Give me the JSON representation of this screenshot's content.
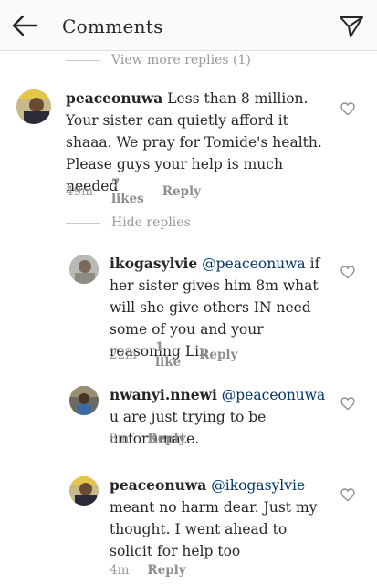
{
  "header": {
    "title": "Comments"
  },
  "view_more": "View more replies (1)",
  "hide_replies": "Hide replies",
  "comments": [
    {
      "username": "peaceonuwa",
      "text": "Less than 8 million. Your sister can quietly afford it shaaa. We pray for Tomide's health. Please guys your help is much needed",
      "time": "49m",
      "likes": "7 likes",
      "reply": "Reply"
    },
    {
      "username": "ikogasylvie",
      "mention": "@peaceonuwa",
      "text": "if her sister gives him 8m what will she give others IN need some of you and your reasoning Lin",
      "time": "22m",
      "likes": "1 like",
      "reply": "Reply"
    },
    {
      "username": "nwanyi.nnewi",
      "mention": "@peaceonuwa",
      "text": "u are just trying to be unfortunate.",
      "time": "8m",
      "reply": "Reply"
    },
    {
      "username": "peaceonuwa",
      "mention": "@ikogasylvie",
      "text": "meant no harm dear. Just my thought. I went ahead to solicit for help too",
      "time": "4m",
      "reply": "Reply"
    }
  ]
}
